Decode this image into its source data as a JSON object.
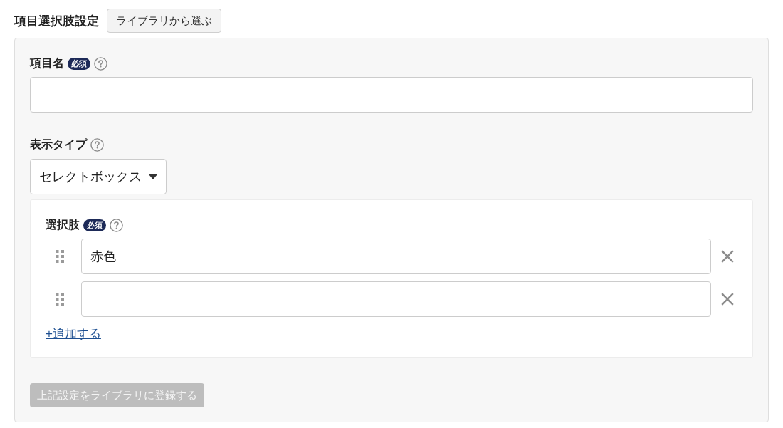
{
  "header": {
    "title": "項目選択肢設定",
    "library_button": "ライブラリから選ぶ"
  },
  "item_name": {
    "label": "項目名",
    "required_badge": "必須"
  },
  "display_type": {
    "label": "表示タイプ",
    "value": "セレクトボックス"
  },
  "choices": {
    "label": "選択肢",
    "required_badge": "必須",
    "items": [
      {
        "kind": "text_input",
        "value": "赤色"
      },
      {
        "kind": "text_input"
      }
    ],
    "add_link": "+追加する"
  },
  "register_button": {
    "label": "上記設定をライブラリに登録する",
    "disabled": true
  }
}
